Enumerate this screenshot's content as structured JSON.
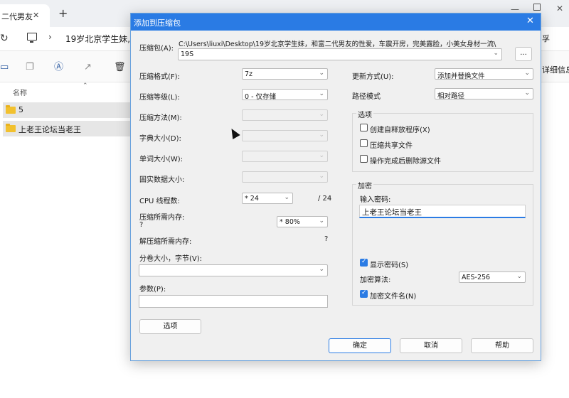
{
  "explorer": {
    "tab_title": "二代男友",
    "tab_close": "✕",
    "tab_add": "+",
    "win_min": "—",
    "win_close": "✕",
    "refresh": "↻",
    "chevron": "›",
    "address": "19岁北京学生妹,",
    "address_right": "孚",
    "details": "详细信息",
    "column_name": "名称",
    "sort_icon": "⌃",
    "files": [
      {
        "name": "5"
      },
      {
        "name": "上老王论坛当老王"
      }
    ]
  },
  "dialog": {
    "title": "添加到压缩包",
    "close": "✕",
    "archive": {
      "label": "压缩包(A):",
      "path": "C:\\Users\\liuxi\\Desktop\\19岁北京学生妹，和富二代男友的性爱，车震开房，完美露脸，小美女身材一流\\",
      "value": "19S",
      "browse": "..."
    },
    "left": {
      "format": {
        "label": "压缩格式(F):",
        "value": "7z"
      },
      "level": {
        "label": "压缩等级(L):",
        "value": "0 - 仅存储"
      },
      "method": {
        "label": "压缩方法(M):",
        "value": ""
      },
      "dict": {
        "label": "字典大小(D):",
        "value": ""
      },
      "word": {
        "label": "单词大小(W):",
        "value": ""
      },
      "solid": {
        "label": "固实数据大小:",
        "value": ""
      },
      "threads": {
        "label": "CPU 线程数:",
        "value": "* 24",
        "max": "/ 24"
      },
      "mem_comp": {
        "label": "压缩所需内存:",
        "sub": "?",
        "value": "* 80%"
      },
      "mem_decomp": {
        "label": "解压缩所需内存:",
        "value": "?"
      },
      "volume": {
        "label": "分卷大小，字节(V):",
        "value": ""
      },
      "params": {
        "label": "参数(P):",
        "value": ""
      },
      "options_btn": "选项"
    },
    "right": {
      "update": {
        "label": "更新方式(U):",
        "value": "添加并替换文件"
      },
      "pathmode": {
        "label": "路径模式",
        "value": "相对路径"
      },
      "options_group": "选项",
      "opt_sfx": "创建自释放程序(X)",
      "opt_shared": "压缩共享文件",
      "opt_delete": "操作完成后删除源文件",
      "encrypt_group": "加密",
      "password_label": "输入密码:",
      "password_value": "上老王论坛当老王",
      "show_password": "显示密码(S)",
      "algo_label": "加密算法:",
      "algo_value": "AES-256",
      "encrypt_names": "加密文件名(N)"
    },
    "buttons": {
      "ok": "确定",
      "cancel": "取消",
      "help": "帮助"
    }
  },
  "colors": {
    "accent": "#2a7be4",
    "folder": "#f2c12e"
  }
}
